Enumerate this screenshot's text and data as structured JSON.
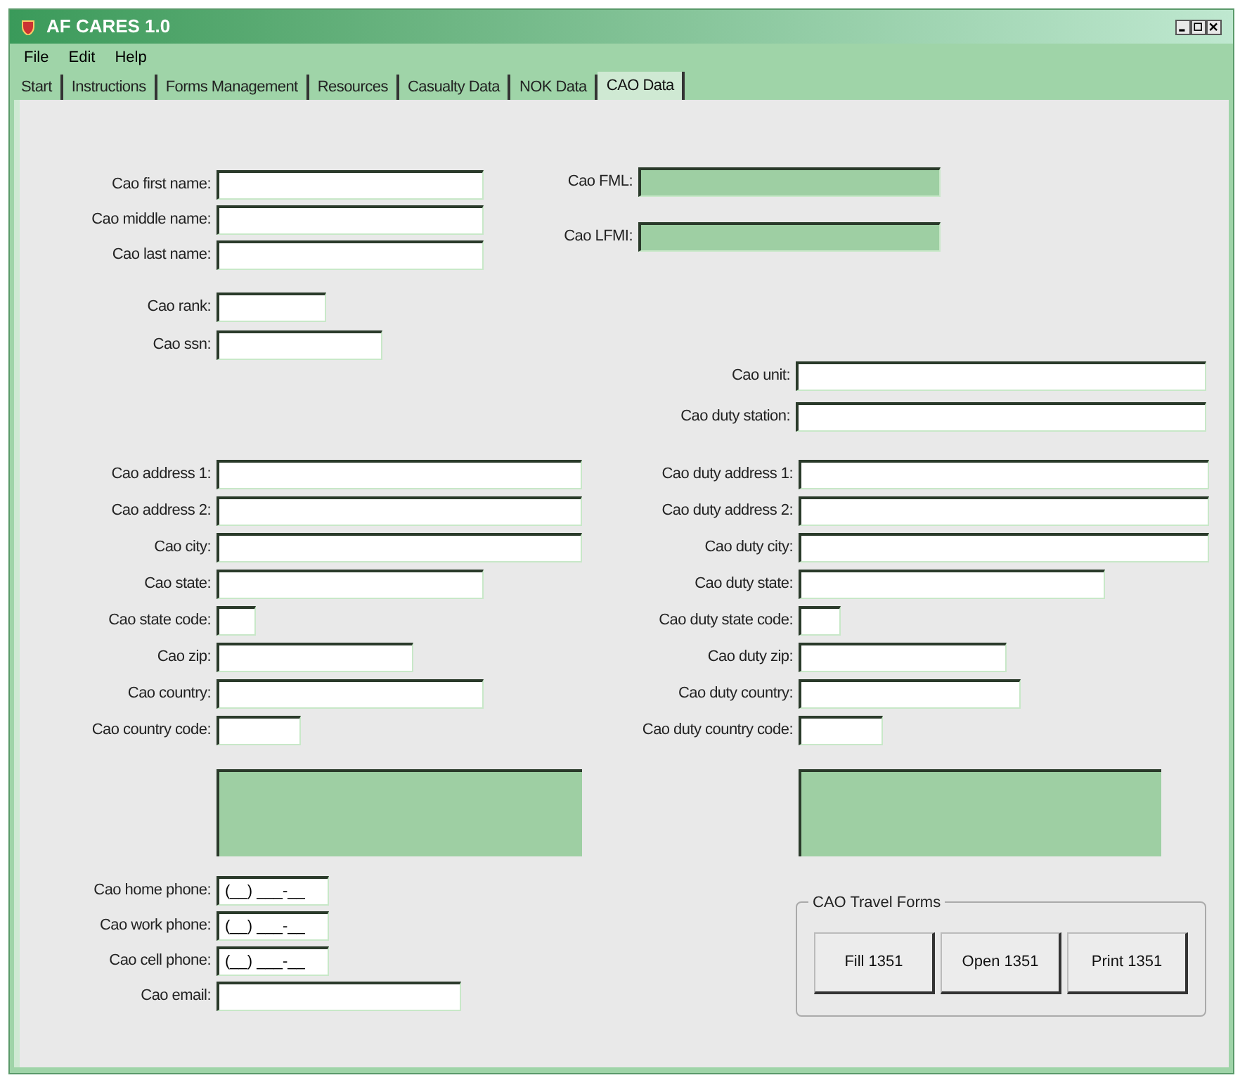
{
  "window": {
    "title": "AF CARES 1.0"
  },
  "menu": [
    "File",
    "Edit",
    "Help"
  ],
  "tabs": [
    {
      "label": "Start",
      "selected": false
    },
    {
      "label": "Instructions",
      "selected": false
    },
    {
      "label": "Forms Management",
      "selected": false
    },
    {
      "label": "Resources",
      "selected": false
    },
    {
      "label": "Casualty Data",
      "selected": false
    },
    {
      "label": "NOK Data",
      "selected": false
    },
    {
      "label": "CAO Data",
      "selected": true
    }
  ],
  "name_fields": [
    {
      "label": "Cao first name:"
    },
    {
      "label": "Cao middle name:"
    },
    {
      "label": "Cao last name:"
    }
  ],
  "id_fields": [
    {
      "label": "Cao rank:"
    },
    {
      "label": "Cao ssn:"
    }
  ],
  "display_fields": [
    {
      "label": "Cao FML:"
    },
    {
      "label": "Cao LFMI:"
    }
  ],
  "unit_fields": [
    {
      "label": "Cao unit:"
    },
    {
      "label": "Cao duty station:"
    }
  ],
  "address_fields": [
    {
      "label": "Cao address 1:"
    },
    {
      "label": "Cao address 2:"
    },
    {
      "label": "Cao city:"
    },
    {
      "label": "Cao state:"
    },
    {
      "label": "Cao state code:"
    },
    {
      "label": "Cao zip:"
    },
    {
      "label": "Cao country:"
    },
    {
      "label": "Cao country code:"
    }
  ],
  "duty_address_fields": [
    {
      "label": "Cao duty address 1:"
    },
    {
      "label": "Cao duty address 2:"
    },
    {
      "label": "Cao duty city:"
    },
    {
      "label": "Cao duty state:"
    },
    {
      "label": "Cao duty state code:"
    },
    {
      "label": "Cao duty zip:"
    },
    {
      "label": "Cao duty country:"
    },
    {
      "label": "Cao duty country code:"
    }
  ],
  "contact_fields": [
    {
      "label": "Cao home phone:",
      "value": "(__) ___-__"
    },
    {
      "label": "Cao work phone:",
      "value": "(__) ___-__"
    },
    {
      "label": "Cao cell phone:",
      "value": "(__) ___-__"
    },
    {
      "label": "Cao email:"
    }
  ],
  "travel_forms": {
    "title": "CAO Travel Forms",
    "buttons": [
      "Fill 1351",
      "Open 1351",
      "Print 1351"
    ]
  }
}
